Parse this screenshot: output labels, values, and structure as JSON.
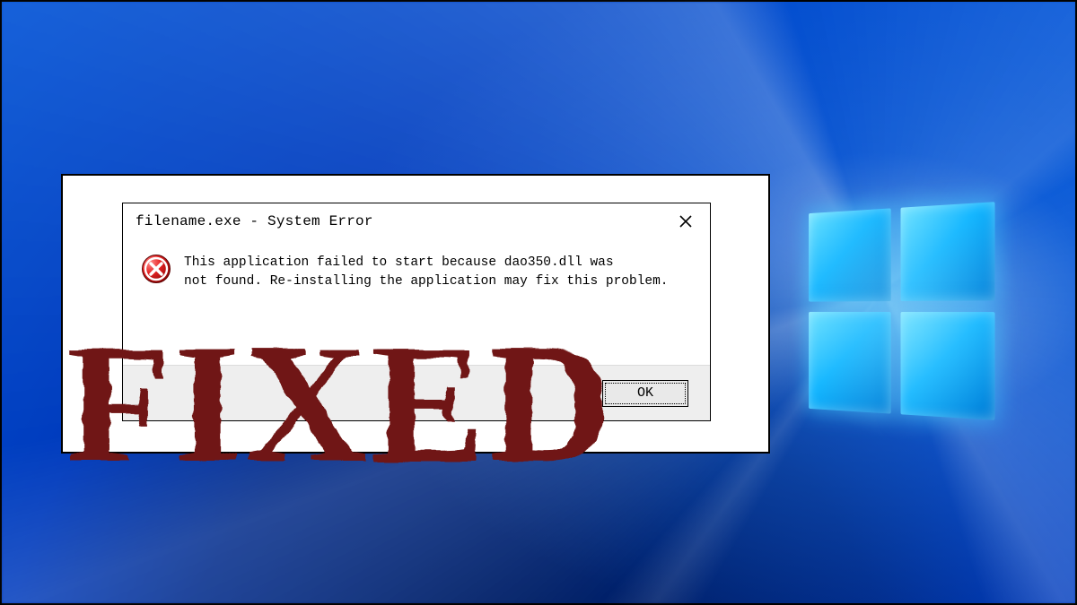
{
  "dialog": {
    "title": "filename.exe - System Error",
    "message": "This application failed to start because dao350.dll was\nnot found. Re-installing the application may fix this problem.",
    "ok_label": "OK"
  },
  "overlay": {
    "stamp_text": "FIXED"
  },
  "icons": {
    "close": "close-icon",
    "error": "error-icon"
  },
  "colors": {
    "stamp": "#6f1412",
    "wallpaper_deep": "#002a8a",
    "logo_glow": "#13b6ff"
  }
}
